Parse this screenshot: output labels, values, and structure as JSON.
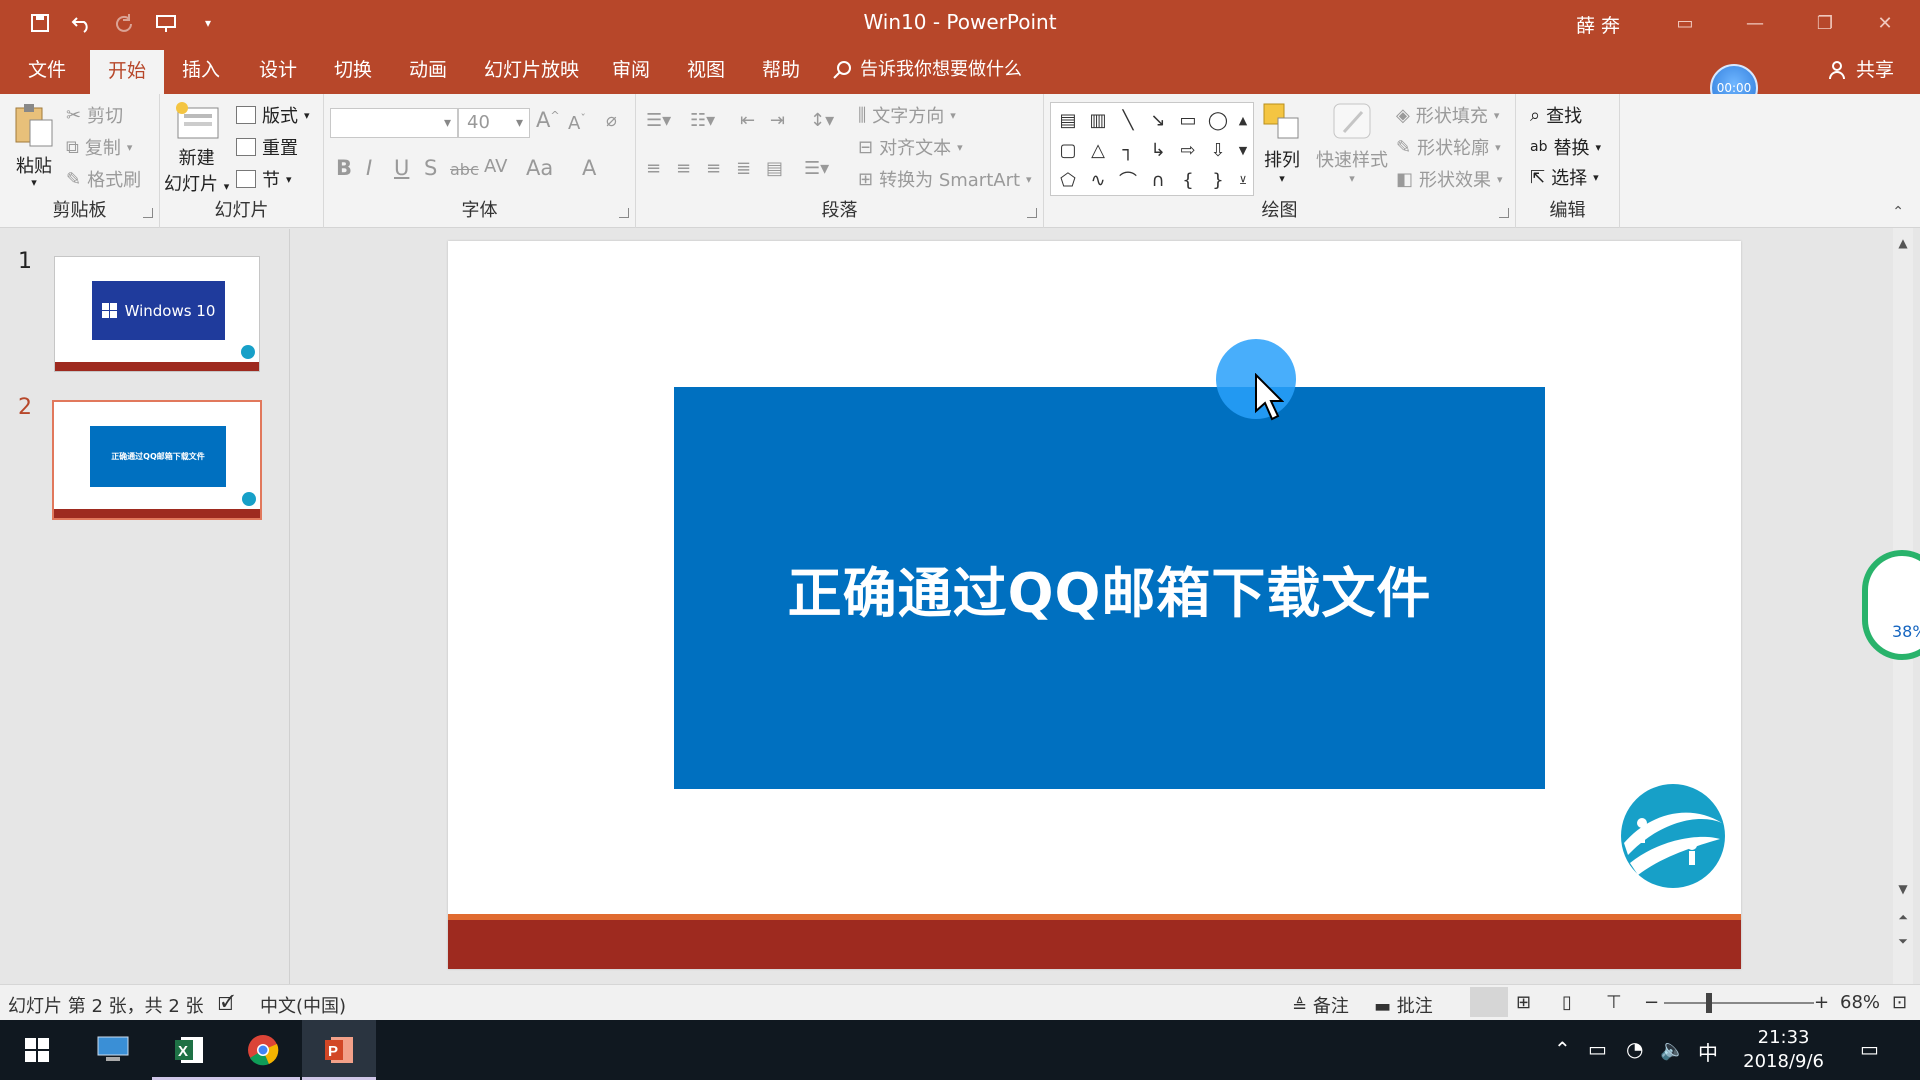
{
  "window": {
    "title": "Win10  -  PowerPoint",
    "user": "薛 奔"
  },
  "tabs": [
    "文件",
    "开始",
    "插入",
    "设计",
    "切换",
    "动画",
    "幻灯片放映",
    "审阅",
    "视图",
    "帮助"
  ],
  "tell_me": "告诉我你想要做什么",
  "share": "共享",
  "timer": "00:00",
  "ribbon": {
    "clipboard": {
      "paste": "粘贴",
      "cut": "剪切",
      "copy": "复制",
      "format_painter": "格式刷",
      "label": "剪贴板"
    },
    "slides": {
      "new_slide_line1": "新建",
      "new_slide_line2": "幻灯片",
      "layout": "版式",
      "reset": "重置",
      "section": "节",
      "label": "幻灯片"
    },
    "font": {
      "font_size": "40",
      "bold": "B",
      "italic": "I",
      "underline": "U",
      "shadow": "S",
      "strike": "abc",
      "spacing": "AV",
      "case": "Aa",
      "color": "A",
      "label": "字体"
    },
    "paragraph": {
      "text_direction": "文字方向",
      "align_text": "对齐文本",
      "smartart": "转换为 SmartArt",
      "label": "段落"
    },
    "drawing": {
      "arrange": "排列",
      "quick_styles": "快速样式",
      "shape_fill": "形状填充",
      "shape_outline": "形状轮廓",
      "shape_effects": "形状效果",
      "label": "绘图"
    },
    "editing": {
      "find": "查找",
      "replace": "替换",
      "select": "选择",
      "label": "编辑"
    }
  },
  "thumbnails": [
    {
      "num": "1",
      "text": "Windows 10"
    },
    {
      "num": "2",
      "text": "正确通过QQ邮箱下载文件"
    }
  ],
  "slide": {
    "title": "正确通过QQ邮箱下载文件"
  },
  "side_widget": {
    "percent": "38%"
  },
  "status": {
    "slide_info": "幻灯片 第 2 张，共 2 张",
    "language": "中文(中国)",
    "notes": "备注",
    "comments": "批注",
    "zoom": "68%"
  },
  "taskbar": {
    "time": "21:33",
    "date": "2018/9/6",
    "ime": "中"
  },
  "colors": {
    "accent": "#b7472a",
    "slide_box": "#0070c0",
    "slide_bar": "#9e2a1f"
  }
}
